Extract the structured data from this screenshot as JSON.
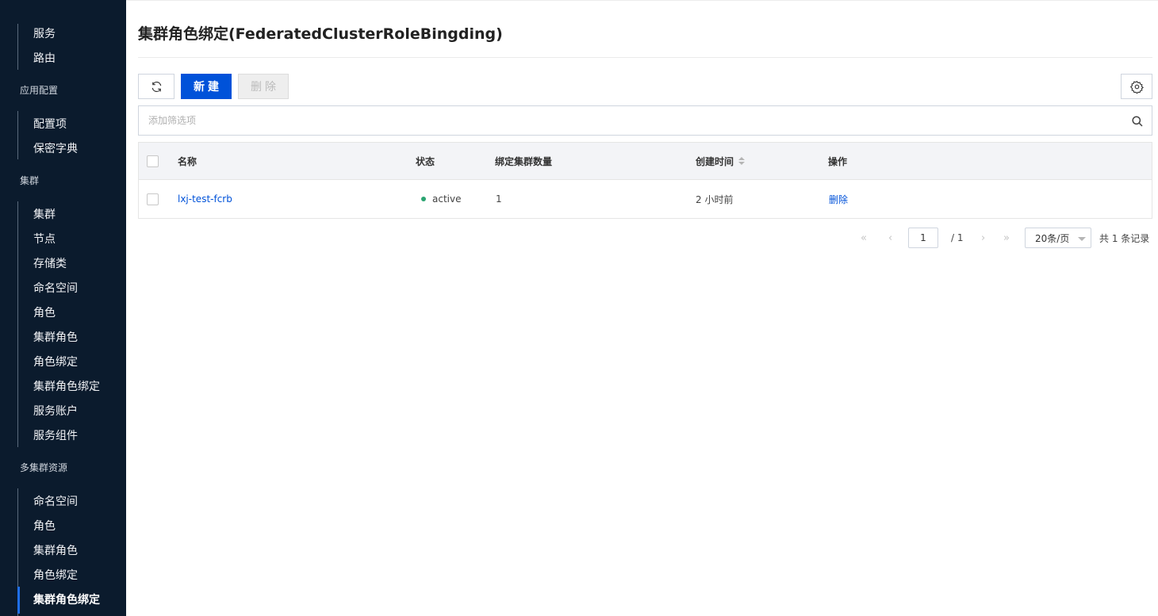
{
  "sidebar": {
    "top_items": [
      "服务",
      "路由"
    ],
    "groups": [
      {
        "title": "应用配置",
        "items": [
          "配置项",
          "保密字典"
        ]
      },
      {
        "title": "集群",
        "items": [
          "集群",
          "节点",
          "存储类",
          "命名空间",
          "角色",
          "集群角色",
          "角色绑定",
          "集群角色绑定",
          "服务账户",
          "服务组件"
        ]
      },
      {
        "title": "多集群资源",
        "items": [
          "命名空间",
          "角色",
          "集群角色",
          "角色绑定",
          "集群角色绑定"
        ]
      }
    ],
    "active_item": "集群角色绑定"
  },
  "page": {
    "title": "集群角色绑定(FederatedClusterRoleBingding)"
  },
  "toolbar": {
    "refresh_icon": "refresh-icon",
    "create_label": "新建",
    "delete_label": "删除",
    "settings_icon": "gear-icon"
  },
  "filter": {
    "placeholder": "添加筛选项",
    "value": "",
    "search_icon": "search-icon"
  },
  "table": {
    "columns": [
      "名称",
      "状态",
      "绑定集群数量",
      "创建时间",
      "操作"
    ],
    "rows": [
      {
        "name": "lxj-test-fcrb",
        "status": "active",
        "cluster_count": "1",
        "created": "2 小时前",
        "action": "删除"
      }
    ],
    "status_color": "#2ba471"
  },
  "pagination": {
    "current_page": "1",
    "total_pages": "/ 1",
    "page_size": "20条/页",
    "total": "共 1 条记录"
  },
  "colors": {
    "sidebar_bg": "#0b1b2d",
    "primary": "#0052d9",
    "active_indicator": "#1f6feb"
  }
}
